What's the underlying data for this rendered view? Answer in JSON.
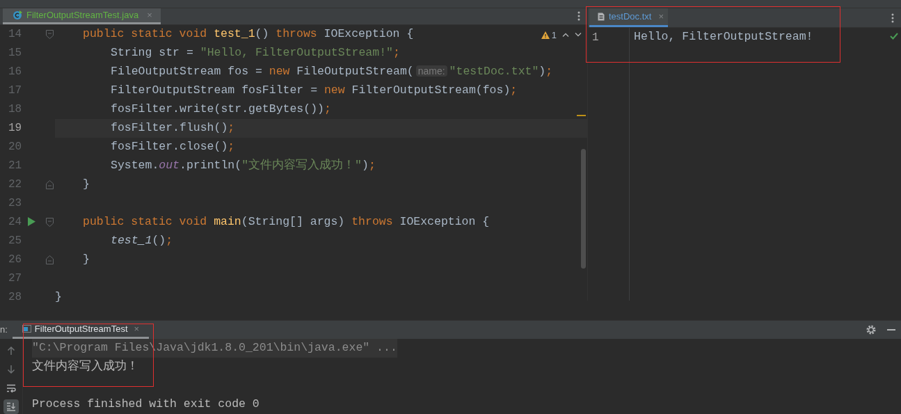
{
  "left_editor": {
    "tab": {
      "label": "FilterOutputStreamTest.java",
      "close": "×",
      "selected": true
    },
    "inspection": {
      "count": "1"
    },
    "lines": [
      {
        "number": "14",
        "kind": "member",
        "current": false,
        "run": false,
        "fold_start": true,
        "fold_end": false,
        "tokens": [
          {
            "kind": "kw",
            "text": "public static void "
          },
          {
            "kind": "decl",
            "text": "test_1"
          },
          {
            "kind": "plain",
            "text": "() "
          },
          {
            "kind": "kw",
            "text": "throws "
          },
          {
            "kind": "plain",
            "text": "IOException {"
          }
        ]
      },
      {
        "number": "15",
        "kind": "body",
        "current": false,
        "run": false,
        "fold_start": false,
        "fold_end": false,
        "tokens": [
          {
            "kind": "plain",
            "text": "String str = "
          },
          {
            "kind": "str",
            "text": "\"Hello, FilterOutputStream!\""
          },
          {
            "kind": "punct",
            "text": ";"
          }
        ]
      },
      {
        "number": "16",
        "kind": "body",
        "current": false,
        "run": false,
        "fold_start": false,
        "fold_end": false,
        "tokens": [
          {
            "kind": "plain",
            "text": "FileOutputStream fos = "
          },
          {
            "kind": "kw",
            "text": "new "
          },
          {
            "kind": "plain",
            "text": "FileOutputStream("
          },
          {
            "kind": "hint",
            "text": "name:"
          },
          {
            "kind": "str",
            "text": "\"testDoc.txt\""
          },
          {
            "kind": "plain",
            "text": ")"
          },
          {
            "kind": "punct",
            "text": ";"
          }
        ]
      },
      {
        "number": "17",
        "kind": "body",
        "current": false,
        "run": false,
        "fold_start": false,
        "fold_end": false,
        "tokens": [
          {
            "kind": "plain",
            "text": "FilterOutputStream fosFilter = "
          },
          {
            "kind": "kw",
            "text": "new "
          },
          {
            "kind": "plain",
            "text": "FilterOutputStream(fos)"
          },
          {
            "kind": "punct",
            "text": ";"
          }
        ]
      },
      {
        "number": "18",
        "kind": "body",
        "current": false,
        "run": false,
        "fold_start": false,
        "fold_end": false,
        "tokens": [
          {
            "kind": "plain",
            "text": "fosFilter.write(str.getBytes())"
          },
          {
            "kind": "punct",
            "text": ";"
          }
        ]
      },
      {
        "number": "19",
        "kind": "body",
        "current": true,
        "run": false,
        "fold_start": false,
        "fold_end": false,
        "tokens": [
          {
            "kind": "plain",
            "text": "fosFilter.flush()"
          },
          {
            "kind": "punct",
            "text": ";"
          }
        ]
      },
      {
        "number": "20",
        "kind": "body",
        "current": false,
        "run": false,
        "fold_start": false,
        "fold_end": false,
        "tokens": [
          {
            "kind": "plain",
            "text": "fosFilter.close()"
          },
          {
            "kind": "punct",
            "text": ";"
          }
        ]
      },
      {
        "number": "21",
        "kind": "body",
        "current": false,
        "run": false,
        "fold_start": false,
        "fold_end": false,
        "tokens": [
          {
            "kind": "plain",
            "text": "System."
          },
          {
            "kind": "field",
            "text": "out"
          },
          {
            "kind": "plain",
            "text": ".println("
          },
          {
            "kind": "str",
            "text": "\"文件内容写入成功！\""
          },
          {
            "kind": "plain",
            "text": ")"
          },
          {
            "kind": "punct",
            "text": ";"
          }
        ]
      },
      {
        "number": "22",
        "kind": "member",
        "current": false,
        "run": false,
        "fold_start": false,
        "fold_end": true,
        "tokens": [
          {
            "kind": "plain",
            "text": "}"
          }
        ]
      },
      {
        "number": "23",
        "kind": "blank",
        "current": false,
        "run": false,
        "fold_start": false,
        "fold_end": false
      },
      {
        "number": "24",
        "kind": "member",
        "current": false,
        "run": true,
        "fold_start": true,
        "fold_end": false,
        "tokens": [
          {
            "kind": "kw",
            "text": "public static void "
          },
          {
            "kind": "decl",
            "text": "main"
          },
          {
            "kind": "plain",
            "text": "(String[] args) "
          },
          {
            "kind": "kw",
            "text": "throws "
          },
          {
            "kind": "plain",
            "text": "IOException {"
          }
        ]
      },
      {
        "number": "25",
        "kind": "body",
        "current": false,
        "run": false,
        "fold_start": false,
        "fold_end": false,
        "tokens": [
          {
            "kind": "italic",
            "text": "test_1"
          },
          {
            "kind": "plain",
            "text": "()"
          },
          {
            "kind": "punct",
            "text": ";"
          }
        ]
      },
      {
        "number": "26",
        "kind": "member",
        "current": false,
        "run": false,
        "fold_start": false,
        "fold_end": true,
        "tokens": [
          {
            "kind": "plain",
            "text": "}"
          }
        ]
      },
      {
        "number": "27",
        "kind": "blank",
        "current": false,
        "run": false,
        "fold_start": false,
        "fold_end": false
      },
      {
        "number": "28",
        "kind": "top",
        "current": false,
        "run": false,
        "fold_start": false,
        "fold_end": false,
        "tokens": [
          {
            "kind": "plain",
            "text": "}"
          }
        ]
      }
    ]
  },
  "right_editor": {
    "tab": {
      "label": "testDoc.txt",
      "close": "×",
      "selected": true
    },
    "lines": [
      {
        "number": "1",
        "text": "Hello, FilterOutputStream!"
      }
    ]
  },
  "run_panel": {
    "label": "n:",
    "tab": {
      "label": "FilterOutputStreamTest",
      "close": "×",
      "selected": true
    },
    "tools": [
      {
        "kind": "up",
        "selected": false
      },
      {
        "kind": "down",
        "selected": false
      },
      {
        "kind": "wrap",
        "selected": false
      },
      {
        "kind": "scroll-end",
        "selected": true
      }
    ],
    "console": [
      {
        "kind": "command",
        "text": "\"C:\\Program Files\\Java\\jdk1.8.0_201\\bin\\java.exe\" ..."
      },
      {
        "kind": "output",
        "text": "文件内容写入成功！"
      },
      {
        "kind": "blank"
      },
      {
        "kind": "output",
        "text": "Process finished with exit code 0"
      }
    ]
  }
}
